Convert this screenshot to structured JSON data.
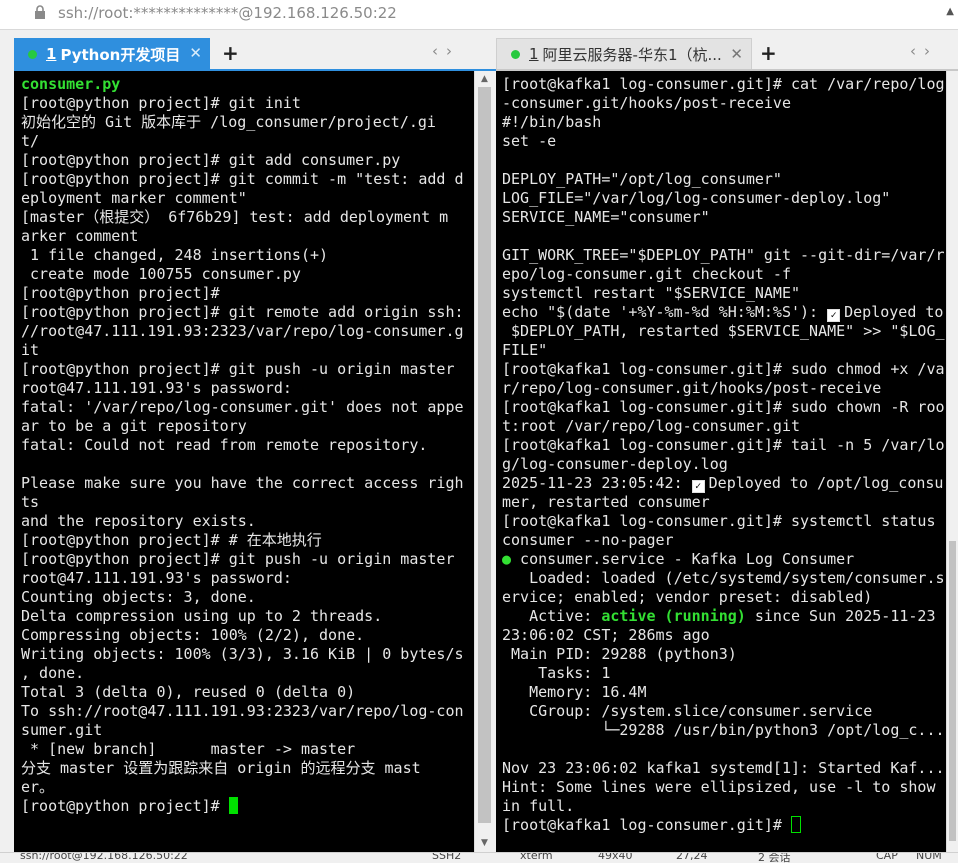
{
  "address_bar": {
    "text": "ssh://root:**************@192.168.126.50:22"
  },
  "left_pane": {
    "tab": {
      "number": "1",
      "title": "Python开发项目"
    },
    "lines": [
      [
        {
          "t": "consumer.py",
          "c": "green"
        }
      ],
      [
        {
          "t": "[root@python project]# git init"
        }
      ],
      [
        {
          "t": "初始化空的 Git 版本库于 /log_consumer/project/.gi"
        }
      ],
      [
        {
          "t": "t/"
        }
      ],
      [
        {
          "t": "[root@python project]# git add consumer.py"
        }
      ],
      [
        {
          "t": "[root@python project]# git commit -m \"test: add d"
        }
      ],
      [
        {
          "t": "eployment marker comment\""
        }
      ],
      [
        {
          "t": "[master（根提交） 6f76b29] test: add deployment m"
        }
      ],
      [
        {
          "t": "arker comment"
        }
      ],
      [
        {
          "t": " 1 file changed, 248 insertions(+)"
        }
      ],
      [
        {
          "t": " create mode 100755 consumer.py"
        }
      ],
      [
        {
          "t": "[root@python project]#"
        }
      ],
      [
        {
          "t": "[root@python project]# git remote add origin ssh:"
        }
      ],
      [
        {
          "t": "//root@47.111.191.93:2323/var/repo/log-consumer.g"
        }
      ],
      [
        {
          "t": "it"
        }
      ],
      [
        {
          "t": "[root@python project]# git push -u origin master"
        }
      ],
      [
        {
          "t": "root@47.111.191.93's password:"
        }
      ],
      [
        {
          "t": "fatal: '/var/repo/log-consumer.git' does not appe"
        }
      ],
      [
        {
          "t": "ar to be a git repository"
        }
      ],
      [
        {
          "t": "fatal: Could not read from remote repository."
        }
      ],
      [
        {
          "t": ""
        }
      ],
      [
        {
          "t": "Please make sure you have the correct access righ"
        }
      ],
      [
        {
          "t": "ts"
        }
      ],
      [
        {
          "t": "and the repository exists."
        }
      ],
      [
        {
          "t": "[root@python project]# # 在本地执行"
        }
      ],
      [
        {
          "t": "[root@python project]# git push -u origin master"
        }
      ],
      [
        {
          "t": "root@47.111.191.93's password:"
        }
      ],
      [
        {
          "t": "Counting objects: 3, done."
        }
      ],
      [
        {
          "t": "Delta compression using up to 2 threads."
        }
      ],
      [
        {
          "t": "Compressing objects: 100% (2/2), done."
        }
      ],
      [
        {
          "t": "Writing objects: 100% (3/3), 3.16 KiB | 0 bytes/s"
        }
      ],
      [
        {
          "t": ", done."
        }
      ],
      [
        {
          "t": "Total 3 (delta 0), reused 0 (delta 0)"
        }
      ],
      [
        {
          "t": "To ssh://root@47.111.191.93:2323/var/repo/log-con"
        }
      ],
      [
        {
          "t": "sumer.git"
        }
      ],
      [
        {
          "t": " * [new branch]      master -> master"
        }
      ],
      [
        {
          "t": "分支 master 设置为跟踪来自 origin 的远程分支 mast"
        }
      ],
      [
        {
          "t": "er。"
        }
      ],
      [
        {
          "t": "[root@python project]# "
        },
        {
          "cursor": "block"
        }
      ]
    ]
  },
  "right_pane": {
    "tab": {
      "number": "1",
      "title": "阿里云服务器-华东1（杭..."
    },
    "lines": [
      [
        {
          "t": "[root@kafka1 log-consumer.git]# cat /var/repo/log"
        }
      ],
      [
        {
          "t": "-consumer.git/hooks/post-receive"
        }
      ],
      [
        {
          "t": "#!/bin/bash"
        }
      ],
      [
        {
          "t": "set -e"
        }
      ],
      [
        {
          "t": ""
        }
      ],
      [
        {
          "t": "DEPLOY_PATH=\"/opt/log_consumer\""
        }
      ],
      [
        {
          "t": "LOG_FILE=\"/var/log/log-consumer-deploy.log\""
        }
      ],
      [
        {
          "t": "SERVICE_NAME=\"consumer\""
        }
      ],
      [
        {
          "t": ""
        }
      ],
      [
        {
          "t": "GIT_WORK_TREE=\"$DEPLOY_PATH\" git --git-dir=/var/r"
        }
      ],
      [
        {
          "t": "epo/log-consumer.git checkout -f"
        }
      ],
      [
        {
          "t": "systemctl restart \"$SERVICE_NAME\""
        }
      ],
      [
        {
          "t": "echo \"$(date '+%Y-%m-%d %H:%M:%S'): "
        },
        {
          "check": true
        },
        {
          "t": "Deployed to"
        }
      ],
      [
        {
          "t": " $DEPLOY_PATH, restarted $SERVICE_NAME\" >> \"$LOG_"
        }
      ],
      [
        {
          "t": "FILE\""
        }
      ],
      [
        {
          "t": "[root@kafka1 log-consumer.git]# sudo chmod +x /va"
        }
      ],
      [
        {
          "t": "r/repo/log-consumer.git/hooks/post-receive"
        }
      ],
      [
        {
          "t": "[root@kafka1 log-consumer.git]# sudo chown -R roo"
        }
      ],
      [
        {
          "t": "t:root /var/repo/log-consumer.git"
        }
      ],
      [
        {
          "t": "[root@kafka1 log-consumer.git]# tail -n 5 /var/lo"
        }
      ],
      [
        {
          "t": "g/log-consumer-deploy.log"
        }
      ],
      [
        {
          "t": "2025-11-23 23:05:42: "
        },
        {
          "check": true
        },
        {
          "t": "Deployed to /opt/log_consu"
        }
      ],
      [
        {
          "t": "mer, restarted consumer"
        }
      ],
      [
        {
          "t": "[root@kafka1 log-consumer.git]# systemctl status"
        }
      ],
      [
        {
          "t": "consumer --no-pager"
        }
      ],
      [
        {
          "t": "●",
          "c": "grn"
        },
        {
          "t": " consumer.service - Kafka Log Consumer"
        }
      ],
      [
        {
          "t": "   Loaded: loaded (/etc/systemd/system/consumer.s"
        }
      ],
      [
        {
          "t": "ervice; enabled; vendor preset: disabled)"
        }
      ],
      [
        {
          "t": "   Active: "
        },
        {
          "t": "active (running)",
          "c": "green"
        },
        {
          "t": " since Sun 2025-11-23"
        }
      ],
      [
        {
          "t": "23:06:02 CST; 286ms ago"
        }
      ],
      [
        {
          "t": " Main PID: 29288 (python3)"
        }
      ],
      [
        {
          "t": "    Tasks: 1"
        }
      ],
      [
        {
          "t": "   Memory: 16.4M"
        }
      ],
      [
        {
          "t": "   CGroup: /system.slice/consumer.service"
        }
      ],
      [
        {
          "t": "           └─29288 /usr/bin/python3 /opt/log_c..."
        }
      ],
      [
        {
          "t": ""
        }
      ],
      [
        {
          "t": "Nov 23 23:06:02 kafka1 systemd[1]: Started Kaf..."
        }
      ],
      [
        {
          "t": "Hint: Some lines were ellipsized, use -l to show"
        }
      ],
      [
        {
          "t": "in full."
        }
      ],
      [
        {
          "t": "[root@kafka1 log-consumer.git]# "
        },
        {
          "cursor": "box"
        }
      ]
    ]
  },
  "status_bar": {
    "connection": "ssh://root@192.168.126.50:22",
    "protocol": "SSH2",
    "terminal_type": "xterm",
    "size": "49x40",
    "cursor_pos": "27,24",
    "sessions": "2 会话",
    "caps": "CAP",
    "num": "NUM"
  },
  "colors": {
    "tab_active": "#2f8fde",
    "terminal_bg": "#000000",
    "terminal_fg": "#e6e6e6",
    "prompt_green": "#33e033"
  }
}
